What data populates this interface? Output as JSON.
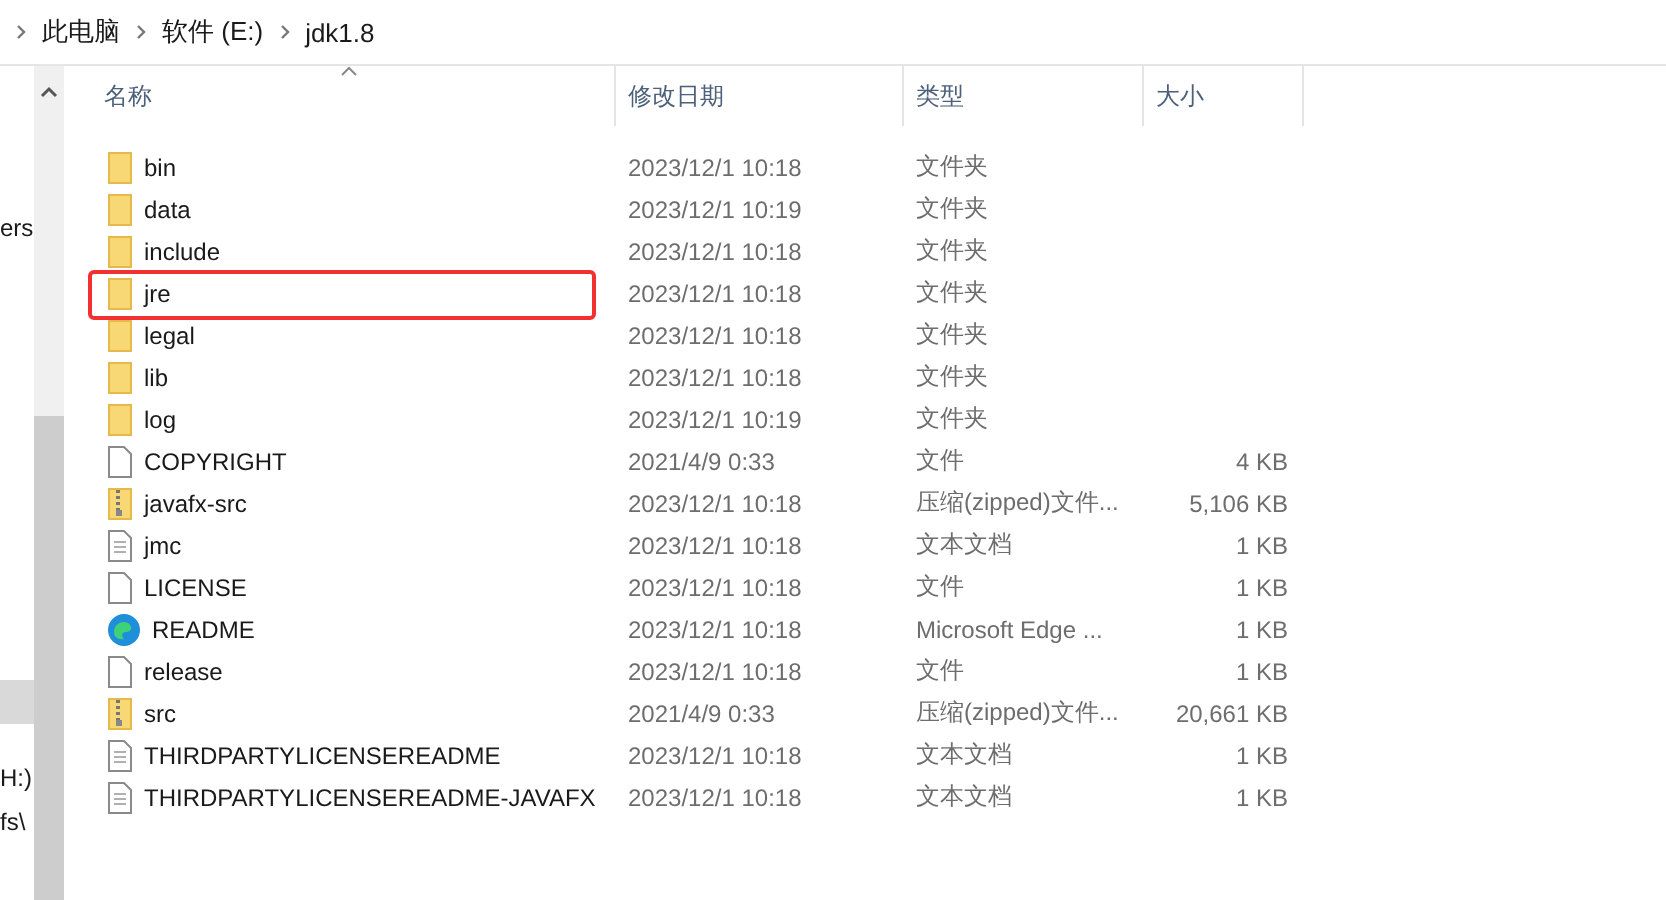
{
  "breadcrumb": [
    "此电脑",
    "软件 (E:)",
    "jdk1.8"
  ],
  "nav_pane": {
    "items": [
      {
        "label": "ers",
        "selected": false
      },
      {
        "selected": true
      },
      {
        "label": "H:)",
        "selected": false
      },
      {
        "label": "fs\\",
        "selected": false
      }
    ]
  },
  "columns": [
    "名称",
    "修改日期",
    "类型",
    "大小"
  ],
  "rows": [
    {
      "kind": "folder",
      "name": "bin",
      "date": "2023/12/1 10:18",
      "type": "文件夹",
      "size": "",
      "highlighted": false
    },
    {
      "kind": "folder",
      "name": "data",
      "date": "2023/12/1 10:19",
      "type": "文件夹",
      "size": "",
      "highlighted": false
    },
    {
      "kind": "folder",
      "name": "include",
      "date": "2023/12/1 10:18",
      "type": "文件夹",
      "size": "",
      "highlighted": false
    },
    {
      "kind": "folder",
      "name": "jre",
      "date": "2023/12/1 10:18",
      "type": "文件夹",
      "size": "",
      "highlighted": true
    },
    {
      "kind": "folder",
      "name": "legal",
      "date": "2023/12/1 10:18",
      "type": "文件夹",
      "size": "",
      "highlighted": false
    },
    {
      "kind": "folder",
      "name": "lib",
      "date": "2023/12/1 10:18",
      "type": "文件夹",
      "size": "",
      "highlighted": false
    },
    {
      "kind": "folder",
      "name": "log",
      "date": "2023/12/1 10:19",
      "type": "文件夹",
      "size": "",
      "highlighted": false
    },
    {
      "kind": "file",
      "name": "COPYRIGHT",
      "date": "2021/4/9 0:33",
      "type": "文件",
      "size": "4 KB",
      "highlighted": false
    },
    {
      "kind": "zip",
      "name": "javafx-src",
      "date": "2023/12/1 10:18",
      "type": "压缩(zipped)文件...",
      "size": "5,106 KB",
      "highlighted": false
    },
    {
      "kind": "text",
      "name": "jmc",
      "date": "2023/12/1 10:18",
      "type": "文本文档",
      "size": "1 KB",
      "highlighted": false
    },
    {
      "kind": "file",
      "name": "LICENSE",
      "date": "2023/12/1 10:18",
      "type": "文件",
      "size": "1 KB",
      "highlighted": false
    },
    {
      "kind": "edge",
      "name": "README",
      "date": "2023/12/1 10:18",
      "type": "Microsoft Edge ...",
      "size": "1 KB",
      "highlighted": false
    },
    {
      "kind": "file",
      "name": "release",
      "date": "2023/12/1 10:18",
      "type": "文件",
      "size": "1 KB",
      "highlighted": false
    },
    {
      "kind": "zip",
      "name": "src",
      "date": "2021/4/9 0:33",
      "type": "压缩(zipped)文件...",
      "size": "20,661 KB",
      "highlighted": false
    },
    {
      "kind": "text",
      "name": "THIRDPARTYLICENSEREADME",
      "date": "2023/12/1 10:18",
      "type": "文本文档",
      "size": "1 KB",
      "highlighted": false
    },
    {
      "kind": "text",
      "name": "THIRDPARTYLICENSEREADME-JAVAFX",
      "date": "2023/12/1 10:18",
      "type": "文本文档",
      "size": "1 KB",
      "highlighted": false
    }
  ]
}
